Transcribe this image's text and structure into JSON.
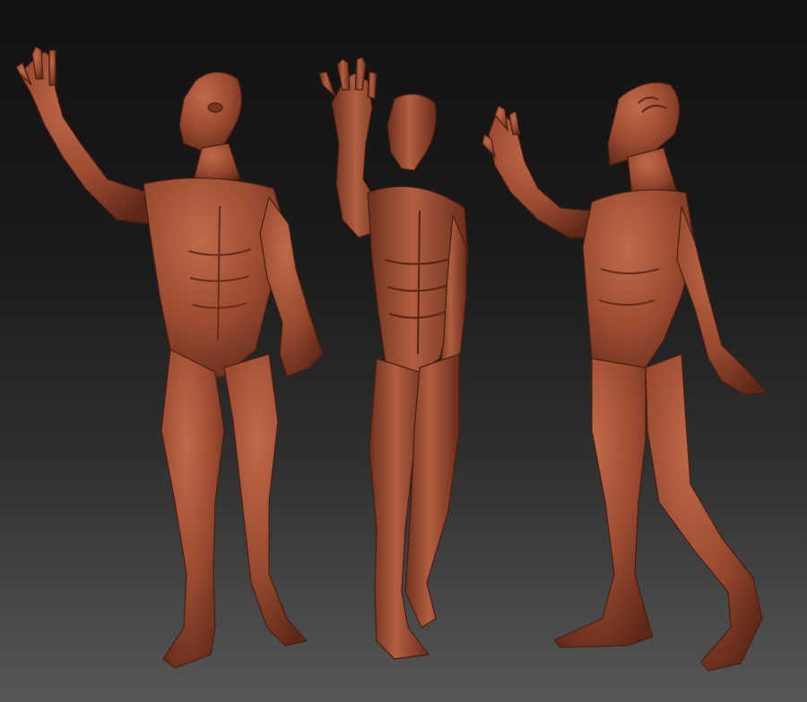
{
  "viewport": {
    "background_top": "#121212",
    "background_bottom": "#575757"
  },
  "figures": [
    {
      "name": "front-three-quarter-view",
      "skin_color": "#9a4a30"
    },
    {
      "name": "front-view",
      "skin_color": "#9a4a30"
    },
    {
      "name": "side-view",
      "skin_color": "#9a4a30"
    }
  ]
}
